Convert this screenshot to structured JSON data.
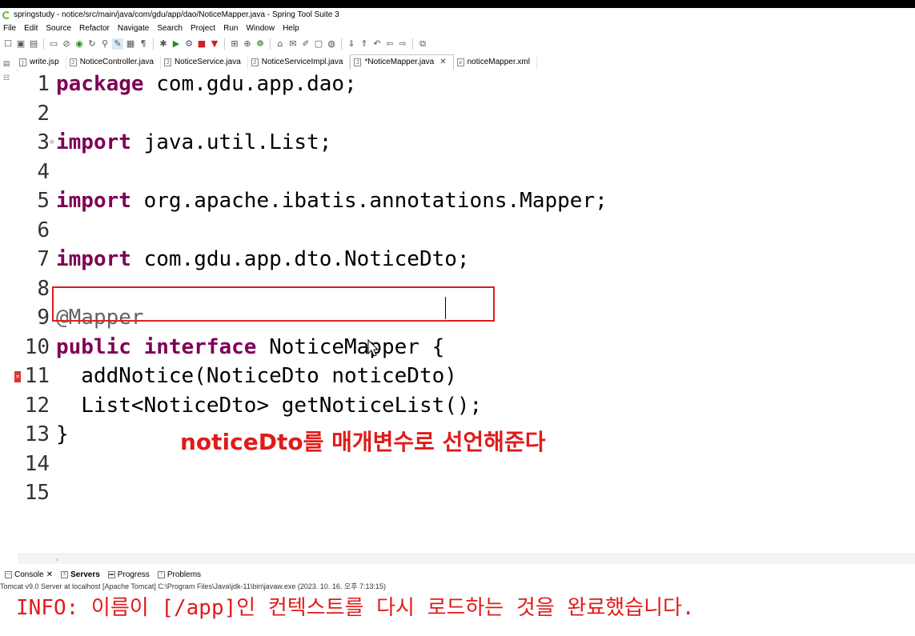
{
  "window": {
    "title": "springstudy - notice/src/main/java/com/gdu/app/dao/NoticeMapper.java - Spring Tool Suite 3"
  },
  "menu": [
    "File",
    "Edit",
    "Source",
    "Refactor",
    "Navigate",
    "Search",
    "Project",
    "Run",
    "Window",
    "Help"
  ],
  "tabs": [
    {
      "label": "write.jsp",
      "active": false,
      "icon": "jsp-file-icon"
    },
    {
      "label": "NoticeController.java",
      "active": false,
      "icon": "java-file-icon"
    },
    {
      "label": "NoticeService.java",
      "active": false,
      "icon": "java-file-icon"
    },
    {
      "label": "NoticeServiceImpl.java",
      "active": false,
      "icon": "java-file-icon"
    },
    {
      "label": "*NoticeMapper.java",
      "active": true,
      "icon": "java-file-icon"
    },
    {
      "label": "noticeMapper.xml",
      "active": false,
      "icon": "xml-file-icon"
    }
  ],
  "code_lines": [
    {
      "num": "1",
      "kw": "package",
      "text": " com.gdu.app.dao;"
    },
    {
      "num": "2",
      "kw": "",
      "text": ""
    },
    {
      "num": "3",
      "kw": "import",
      "text": " java.util.List;",
      "fold": true
    },
    {
      "num": "4",
      "kw": "",
      "text": ""
    },
    {
      "num": "5",
      "kw": "import",
      "text": " org.apache.ibatis.annotations.Mapper;"
    },
    {
      "num": "6",
      "kw": "",
      "text": ""
    },
    {
      "num": "7",
      "kw": "import",
      "text": " com.gdu.app.dto.NoticeDto;"
    },
    {
      "num": "8",
      "kw": "",
      "text": ""
    },
    {
      "num": "9",
      "kw": "",
      "ann": "@Mapper",
      "text": ""
    },
    {
      "num": "10",
      "kw": "public interface",
      "text": " NoticeMapper {"
    },
    {
      "num": "11",
      "kw": "",
      "text": "  addNotice(NoticeDto noticeDto)",
      "error": true
    },
    {
      "num": "12",
      "kw": "",
      "text": "  List<NoticeDto> getNoticeList();"
    },
    {
      "num": "13",
      "kw": "",
      "text": "}"
    },
    {
      "num": "14",
      "kw": "",
      "text": ""
    },
    {
      "num": "15",
      "kw": "",
      "text": ""
    }
  ],
  "annotation_text": "noticeDto를 매개변수로 선언해준다",
  "console_tabs": [
    {
      "label": "Console",
      "active": false,
      "closable": true
    },
    {
      "label": "Servers",
      "active": true
    },
    {
      "label": "Progress",
      "active": false
    },
    {
      "label": "Problems",
      "active": false
    }
  ],
  "console": {
    "header": "Tomcat v9.0 Server at localhost [Apache Tomcat] C:\\Program Files\\Java\\jdk-11\\bin\\javaw.exe  (2023. 10. 16. 오후 7:13:15)",
    "output": "INFO: 이름이 [/app]인 컨텍스트를 다시 로드하는 것을 완료했습니다."
  },
  "colors": {
    "keyword": "#7f0055",
    "highlight_box": "#e01b1b",
    "console_text": "#e01b1b"
  }
}
